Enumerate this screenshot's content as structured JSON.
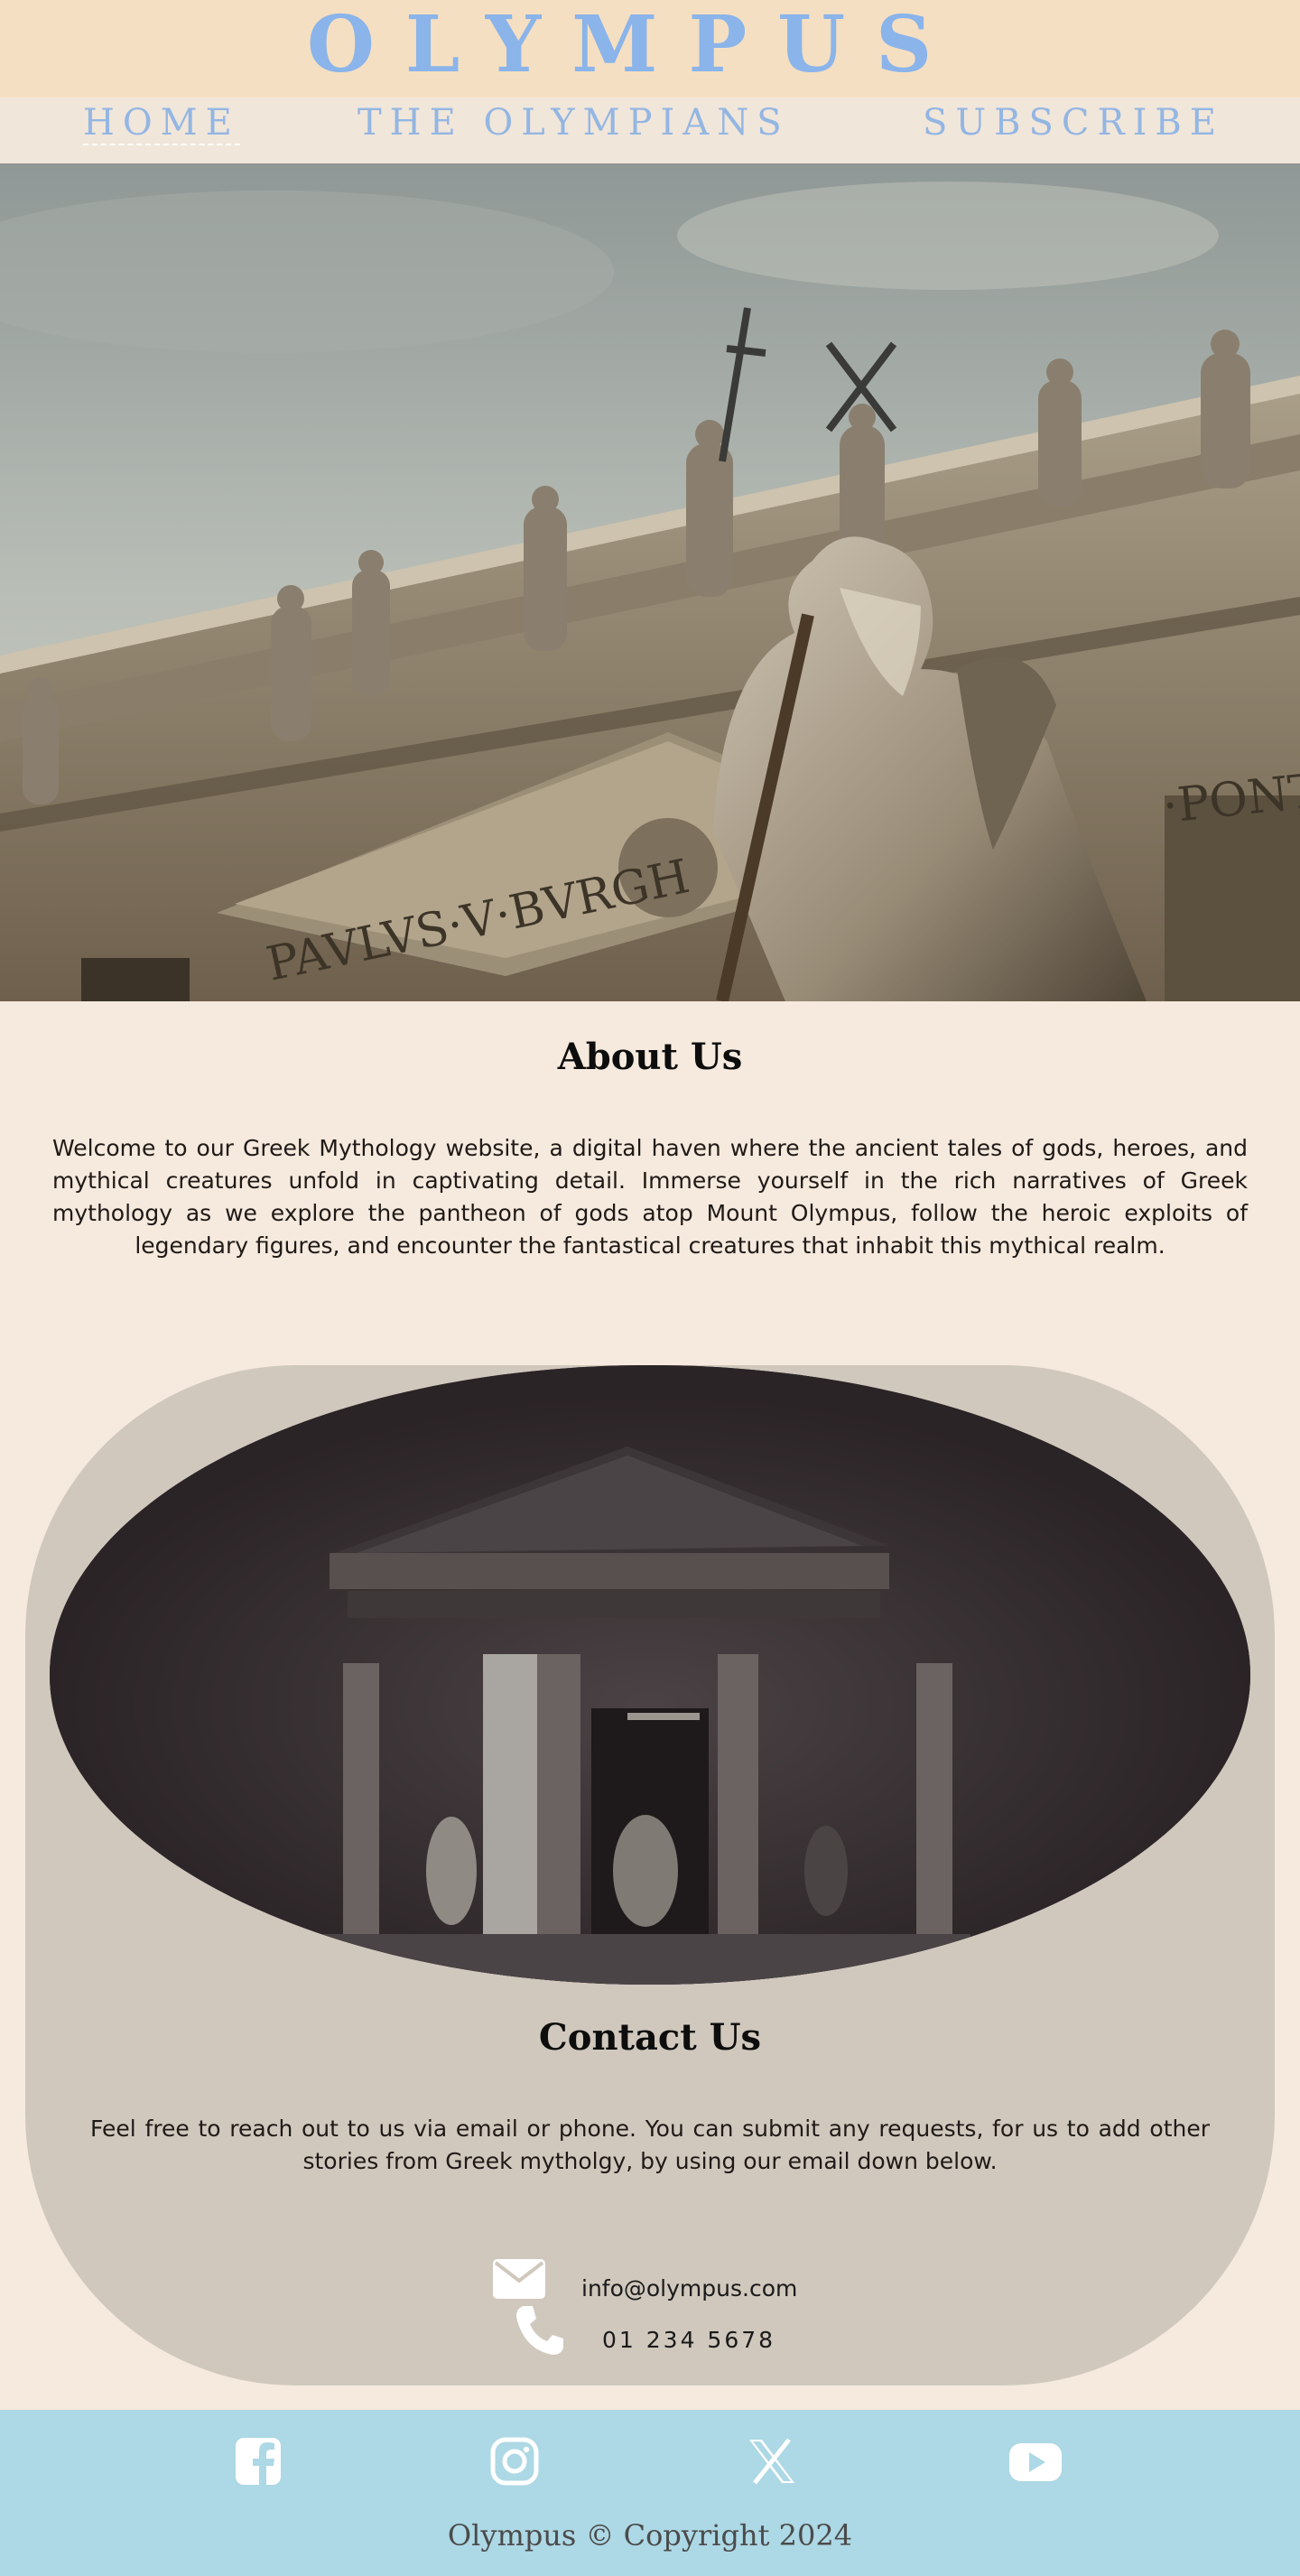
{
  "brand": {
    "title": "OLYMPUS"
  },
  "nav": {
    "items": [
      {
        "label": "HOME",
        "active": true
      },
      {
        "label": "THE OLYMPIANS",
        "active": false
      },
      {
        "label": "SUBSCRIBE",
        "active": false
      }
    ]
  },
  "hero": {
    "inscription_left": "PAVLVS·V·BVRGH",
    "inscription_right": "·PONT"
  },
  "about": {
    "title": "About Us",
    "text": "Welcome to our Greek Mythology website, a digital haven where the ancient tales of gods, heroes, and mythical creatures unfold in captivating detail. Immerse yourself in the rich narratives of Greek mythology as we explore the pantheon of gods atop Mount Olympus, follow the heroic exploits of legendary figures, and encounter the fantastical creatures that inhabit this mythical realm."
  },
  "contact": {
    "title": "Contact Us",
    "text": "Feel free to reach out to us via email or phone. You can submit any requests, for us to add other stories from Greek mytholgy, by using our email down below.",
    "email": "info@olympus.com",
    "phone": "01 234 5678",
    "email_icon": "envelope-icon",
    "phone_icon": "phone-icon"
  },
  "footer": {
    "social": [
      "facebook-icon",
      "instagram-icon",
      "x-icon",
      "youtube-icon"
    ],
    "copyright": "Olympus © Copyright 2024"
  },
  "colors": {
    "brand_bar": "#f5dfc2",
    "nav_bar": "#f1e6da",
    "brand_text": "#8ab4ea",
    "page_bg": "#f6e9dd",
    "contact_card": "#d0c8bd",
    "footer_bg": "#add8e5"
  }
}
